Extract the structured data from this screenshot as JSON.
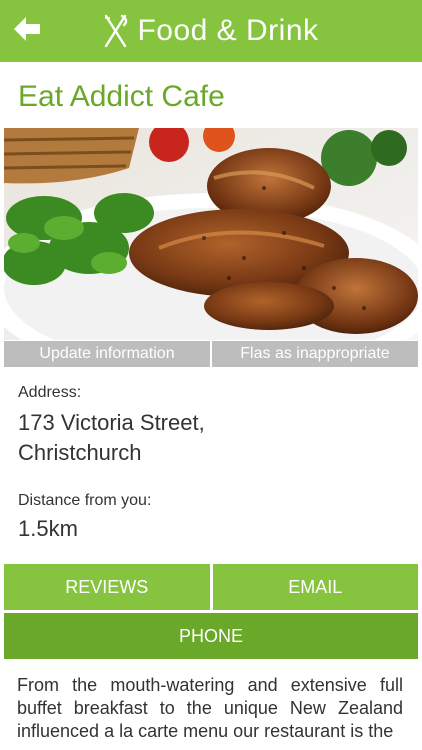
{
  "header": {
    "title": "Food & Drink",
    "back_icon": "back-arrow-icon",
    "logo_icon": "fork-knife-icon",
    "color": "#86c440"
  },
  "restaurant": {
    "name": "Eat Addict Cafe"
  },
  "actions": {
    "update_label": "Update information",
    "flag_label": "Flas as inappropriate"
  },
  "address": {
    "label": "Address:",
    "line1": "173 Victoria Street,",
    "line2": "Christchurch"
  },
  "distance": {
    "label": "Distance from you:",
    "value": "1.5km"
  },
  "buttons": {
    "reviews": "REVIEWS",
    "email": "EMAIL",
    "phone": "PHONE"
  },
  "description": "From the mouth-watering and extensive full buffet breakfast to the unique New Zealand influenced a la carte menu our restaurant is the",
  "colors": {
    "accent": "#86c440",
    "accent_dark": "#6aa82a",
    "muted_button": "#bdbdbd"
  }
}
